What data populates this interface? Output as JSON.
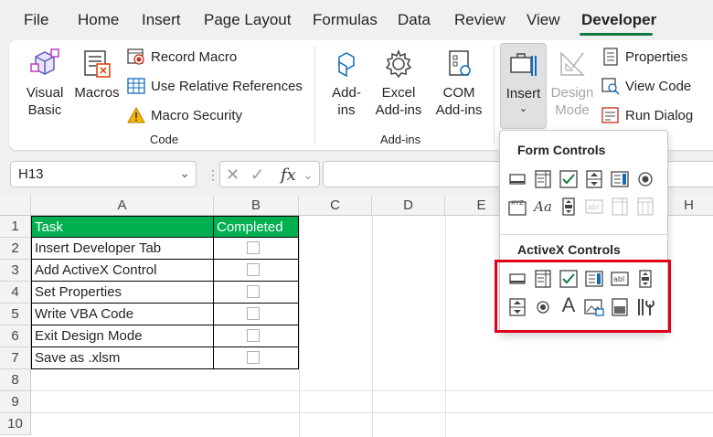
{
  "tabs": [
    {
      "label": "File"
    },
    {
      "label": "Home"
    },
    {
      "label": "Insert"
    },
    {
      "label": "Page Layout"
    },
    {
      "label": "Formulas"
    },
    {
      "label": "Data"
    },
    {
      "label": "Review"
    },
    {
      "label": "View"
    },
    {
      "label": "Developer",
      "active": true
    }
  ],
  "ribbon": {
    "code": {
      "visual_basic": "Visual\nBasic",
      "macros": "Macros",
      "record_macro": "Record Macro",
      "relative_refs": "Use Relative References",
      "macro_security": "Macro Security",
      "label": "Code"
    },
    "addins": {
      "addins": "Add-\nins",
      "excel_addins": "Excel\nAdd-ins",
      "com_addins": "COM\nAdd-ins",
      "label": "Add-ins"
    },
    "controls": {
      "insert": "Insert",
      "design_mode": "Design\nMode",
      "properties": "Properties",
      "view_code": "View Code",
      "run_dialog": "Run Dialog"
    }
  },
  "formula_bar": {
    "name_box": "H13",
    "fx": "fx"
  },
  "sheet": {
    "columns": [
      "A",
      "B",
      "C",
      "D",
      "E",
      "H"
    ],
    "rows": [
      "1",
      "2",
      "3",
      "4",
      "5",
      "6",
      "7",
      "8",
      "9",
      "10"
    ],
    "header": {
      "task": "Task",
      "completed": "Completed"
    },
    "tasks": [
      "Insert Developer Tab",
      "Add ActiveX Control",
      "Set Properties",
      "Write VBA Code",
      "Exit Design Mode",
      "Save as .xlsm"
    ]
  },
  "dropdown": {
    "form_title": "Form Controls",
    "activex_title": "ActiveX Controls",
    "form_controls": [
      "button",
      "combo-box",
      "check-box",
      "spin-button",
      "list-box",
      "option-button",
      "group-box",
      "label",
      "scroll-bar",
      "text-field",
      "combo-list-edit",
      "combo-drop-down"
    ],
    "activex_controls": [
      "command-button",
      "combo-box",
      "check-box",
      "list-box",
      "text-box",
      "scroll-bar",
      "spin-button",
      "option-button",
      "label",
      "image",
      "toggle-button",
      "more-controls"
    ]
  },
  "colors": {
    "header_fill": "#00b050",
    "accent": "#107c41",
    "highlight": "#e0001b"
  }
}
